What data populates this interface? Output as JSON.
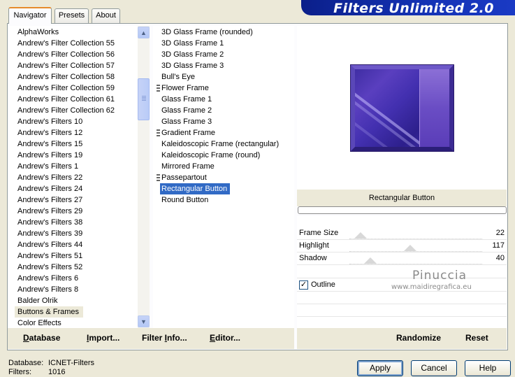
{
  "banner": {
    "title": "Filters Unlimited 2.0"
  },
  "tabs": [
    {
      "label": "Navigator",
      "active": true
    },
    {
      "label": "Presets",
      "active": false
    },
    {
      "label": "About",
      "active": false
    }
  ],
  "categories": [
    {
      "label": "AlphaWorks"
    },
    {
      "label": "Andrew's Filter Collection 55"
    },
    {
      "label": "Andrew's Filter Collection 56"
    },
    {
      "label": "Andrew's Filter Collection 57"
    },
    {
      "label": "Andrew's Filter Collection 58"
    },
    {
      "label": "Andrew's Filter Collection 59"
    },
    {
      "label": "Andrew's Filter Collection 61"
    },
    {
      "label": "Andrew's Filter Collection 62"
    },
    {
      "label": "Andrew's Filters 10"
    },
    {
      "label": "Andrew's Filters 12"
    },
    {
      "label": "Andrew's Filters 15"
    },
    {
      "label": "Andrew's Filters 19"
    },
    {
      "label": "Andrew's Filters 1"
    },
    {
      "label": "Andrew's Filters 22"
    },
    {
      "label": "Andrew's Filters 24"
    },
    {
      "label": "Andrew's Filters 27"
    },
    {
      "label": "Andrew's Filters 29"
    },
    {
      "label": "Andrew's Filters 38"
    },
    {
      "label": "Andrew's Filters 39"
    },
    {
      "label": "Andrew's Filters 44"
    },
    {
      "label": "Andrew's Filters 51"
    },
    {
      "label": "Andrew's Filters 52"
    },
    {
      "label": "Andrew's Filters 6"
    },
    {
      "label": "Andrew's Filters 8"
    },
    {
      "label": "Balder Olrik"
    },
    {
      "label": "Buttons & Frames",
      "highlight": true
    },
    {
      "label": "Color Effects"
    }
  ],
  "filters": [
    {
      "label": "3D Glass Frame (rounded)"
    },
    {
      "label": "3D Glass Frame 1"
    },
    {
      "label": "3D Glass Frame 2"
    },
    {
      "label": "3D Glass Frame 3"
    },
    {
      "label": "Bull's Eye"
    },
    {
      "label": "Flower Frame",
      "grip": true
    },
    {
      "label": "Glass Frame 1"
    },
    {
      "label": "Glass Frame 2"
    },
    {
      "label": "Glass Frame 3"
    },
    {
      "label": "Gradient Frame",
      "grip": true
    },
    {
      "label": "Kaleidoscopic Frame (rectangular)"
    },
    {
      "label": "Kaleidoscopic Frame (round)"
    },
    {
      "label": "Mirrored Frame"
    },
    {
      "label": "Passepartout",
      "grip": true
    },
    {
      "label": "Rectangular Button",
      "selected": true
    },
    {
      "label": "Round Button"
    }
  ],
  "left_bar": {
    "database": {
      "pre": "",
      "u": "D",
      "post": "atabase"
    },
    "import": {
      "pre": "",
      "u": "I",
      "post": "mport..."
    },
    "filter_info": {
      "pre": "Filter ",
      "u": "I",
      "post": "nfo..."
    },
    "editor": {
      "pre": "",
      "u": "E",
      "post": "ditor..."
    }
  },
  "effect": {
    "name": "Rectangular Button"
  },
  "controls": [
    {
      "label": "Frame Size",
      "value": "22",
      "level": 0.086
    },
    {
      "label": "Highlight",
      "value": "117",
      "level": 0.459
    },
    {
      "label": "Shadow",
      "value": "40",
      "level": 0.157
    }
  ],
  "outline": {
    "label": "Outline",
    "checked": true,
    "mark": "✓"
  },
  "right_bar": {
    "randomize": "Randomize",
    "reset": "Reset"
  },
  "watermark": {
    "name": "Pinuccia",
    "site": "www.maidiregrafica.eu"
  },
  "footer": {
    "database_label": "Database:",
    "database_value": "ICNET-Filters",
    "filters_label": "Filters:",
    "filters_value": "1016"
  },
  "buttons": {
    "apply": "Apply",
    "cancel": "Cancel",
    "help": "Help"
  },
  "icons": {
    "scroll_up": "chevron-up-icon",
    "scroll_down": "chevron-down-icon"
  },
  "colors": {
    "selection": "#316ac5",
    "banner": "#0b1f8a",
    "tab_accent": "#e68b2c"
  }
}
